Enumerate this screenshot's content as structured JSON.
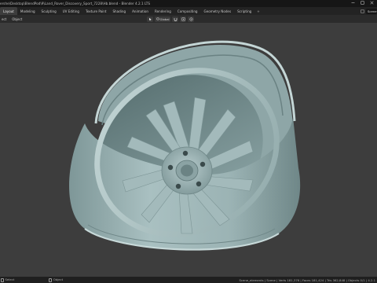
{
  "window": {
    "title": "ershe\\Desktop\\BlendPod\\9\\Land_Rover_Discovery_Sport_7228\\Hb.blend - Blender 4.2.1 LTS"
  },
  "workspaces": {
    "tabs": [
      "Layout",
      "Modeling",
      "Sculpting",
      "UV Editing",
      "Texture Paint",
      "Shading",
      "Animation",
      "Rendering",
      "Compositing",
      "Geometry Nodes",
      "Scripting"
    ],
    "active": "Layout",
    "add_label": "+",
    "scene_label": "Scene"
  },
  "viewport_header": {
    "menus": [
      "ect",
      "Object"
    ],
    "transform_orientation": "Global"
  },
  "status": {
    "left_items": [
      "Select",
      "Object"
    ],
    "stats": "Scene_elements | Scene | Verts 181,376 | Faces 181,424 | Tris 362,848 | Objects 0/1 | 4.2.1"
  },
  "colors": {
    "viewport_bg": "#3d3d3d",
    "wheel_base": "#9bb3b4",
    "wheel_shadow": "#6f8788",
    "wheel_highlight": "#c9dcdc"
  },
  "icons": [
    "minimize-icon",
    "maximize-icon",
    "close-icon",
    "cursor-icon",
    "globe-icon",
    "magnet-icon",
    "snap-icon",
    "proportional-icon",
    "mouse-icon"
  ]
}
